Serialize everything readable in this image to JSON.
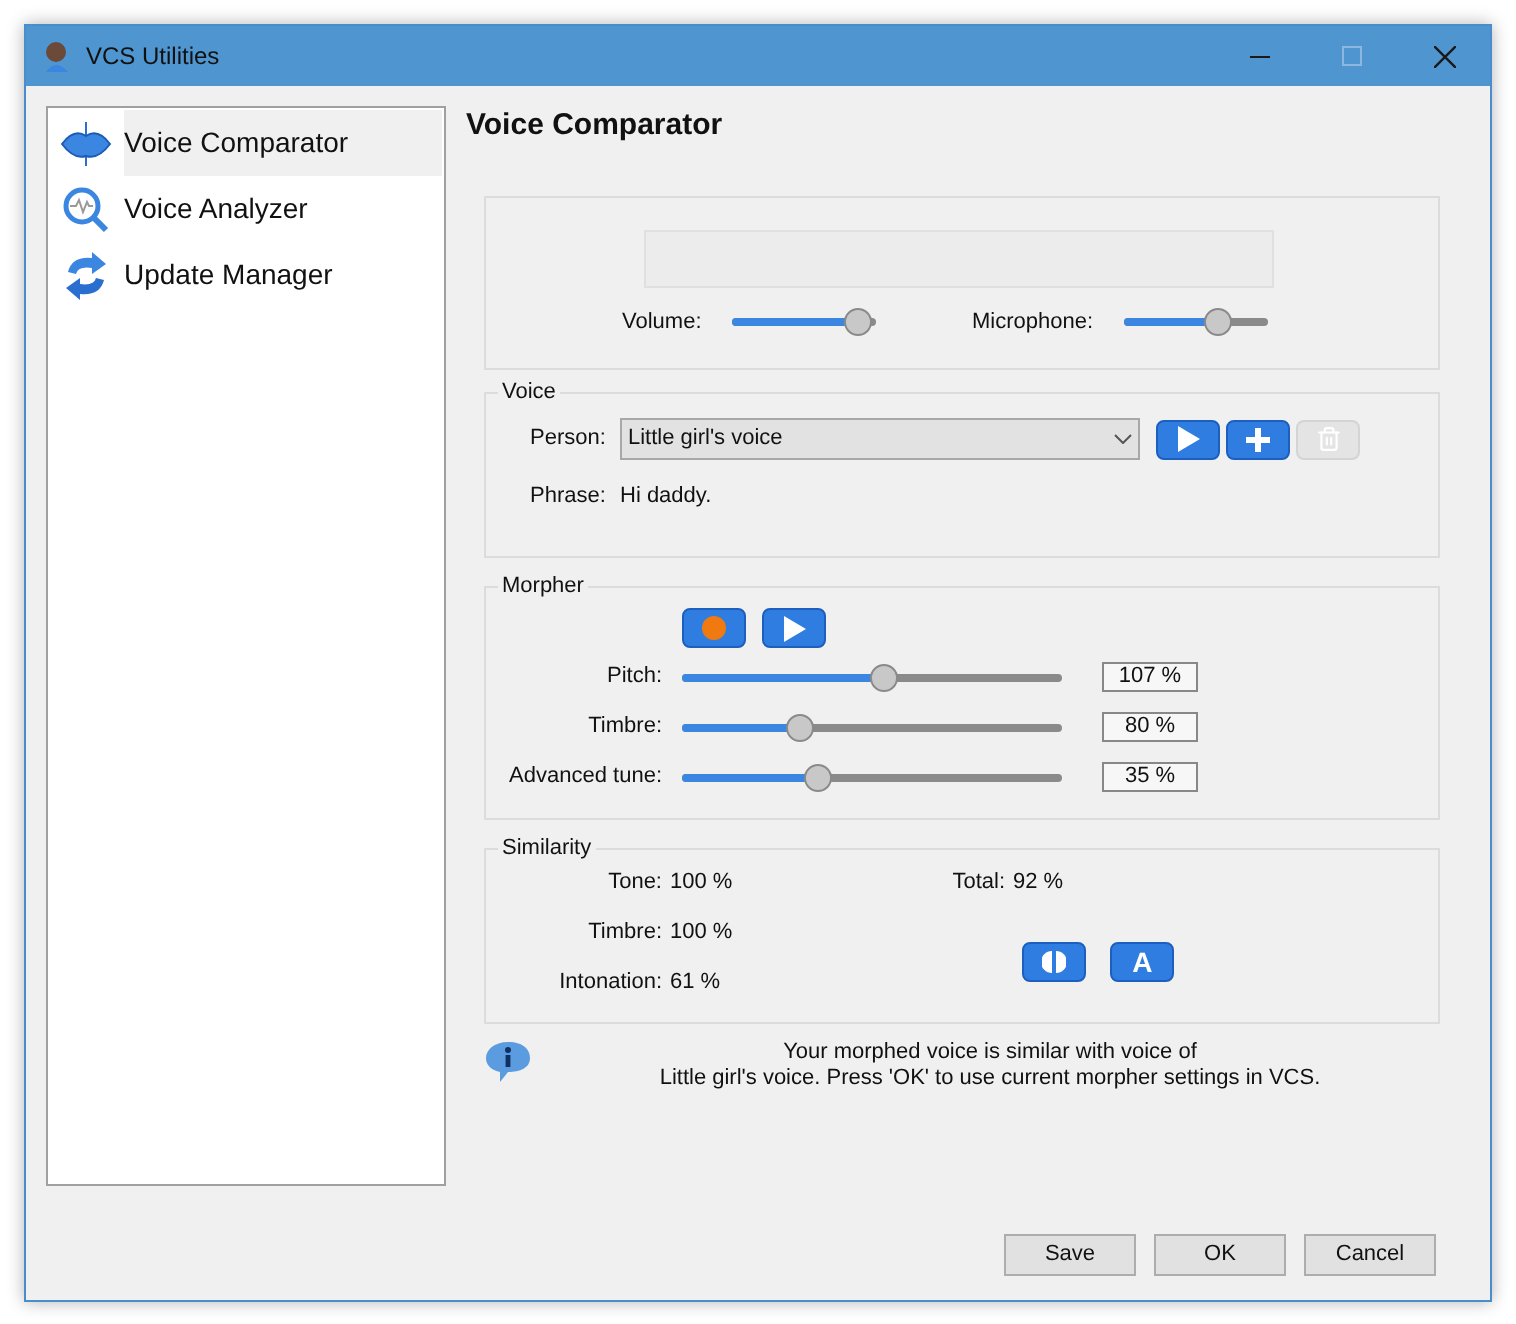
{
  "window": {
    "title": "VCS Utilities",
    "maximize_disabled": true
  },
  "sidebar": {
    "items": [
      {
        "label": "Voice Comparator",
        "kind": "comparator",
        "selected": true
      },
      {
        "label": "Voice Analyzer",
        "kind": "analyzer",
        "selected": false
      },
      {
        "label": "Update Manager",
        "kind": "update",
        "selected": false
      }
    ]
  },
  "heading": "Voice Comparator",
  "levels": [
    {
      "label": "Volume:",
      "level": 0.88
    },
    {
      "label": "Microphone:",
      "level": 0.65
    }
  ],
  "voice": {
    "legend": "Voice",
    "person_label": "Person:",
    "person_value": "Little girl's voice",
    "phrase_label": "Phrase:",
    "phrase_value": "Hi daddy.",
    "buttons": [
      {
        "kind": "play",
        "disabled": false
      },
      {
        "kind": "add",
        "disabled": false
      },
      {
        "kind": "delete",
        "disabled": true
      }
    ]
  },
  "morpher": {
    "legend": "Morpher",
    "buttons": [
      {
        "kind": "record"
      },
      {
        "kind": "play"
      }
    ],
    "sliders": [
      {
        "label": "Pitch:",
        "level": 0.53,
        "reading": "107 %"
      },
      {
        "label": "Timbre:",
        "level": 0.31,
        "reading": "80 %"
      },
      {
        "label": "Advanced tune:",
        "level": 0.36,
        "reading": "35 %"
      }
    ]
  },
  "similarity": {
    "legend": "Similarity",
    "rows": [
      {
        "label": "Tone:",
        "value": "100 %"
      },
      {
        "label": "Timbre:",
        "value": "100 %"
      },
      {
        "label": "Intonation:",
        "value": "61 %"
      }
    ],
    "total_label": "Total:",
    "total_value": "92 %",
    "buttons": [
      {
        "kind": "compare"
      },
      {
        "kind": "text",
        "label": "A"
      }
    ]
  },
  "message": [
    "Your morphed voice is similar with voice of",
    "Little girl's voice. Press 'OK' to use current morpher settings in VCS."
  ],
  "buttons": [
    "Save",
    "OK",
    "Cancel"
  ]
}
